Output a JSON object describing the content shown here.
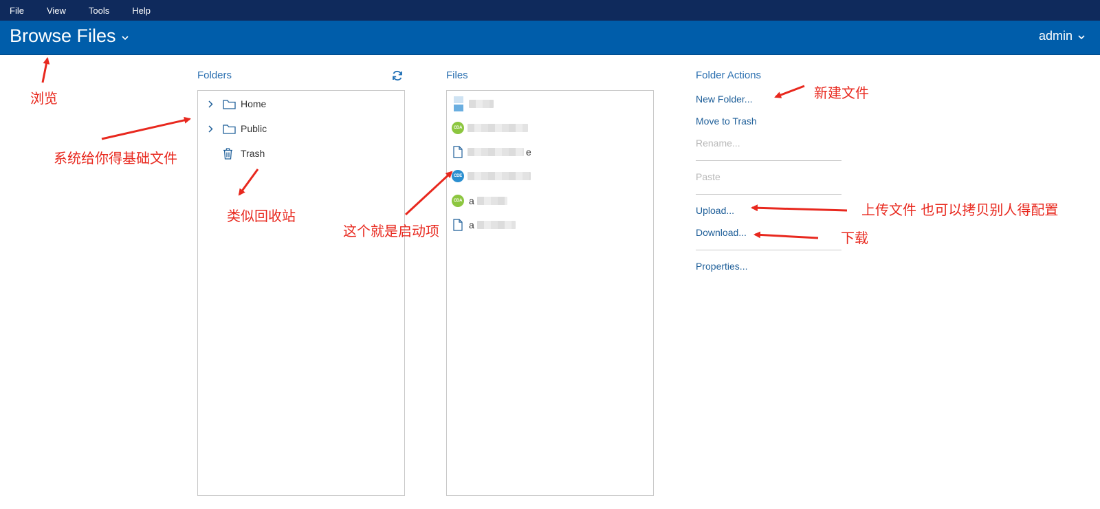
{
  "menubar": {
    "items": [
      "File",
      "View",
      "Tools",
      "Help"
    ]
  },
  "header": {
    "title": "Browse Files",
    "user": "admin"
  },
  "folders": {
    "title": "Folders",
    "items": [
      {
        "label": "Home",
        "icon": "folder-icon",
        "expandable": true
      },
      {
        "label": "Public",
        "icon": "folder-icon",
        "expandable": true
      },
      {
        "label": "Trash",
        "icon": "trash-icon",
        "expandable": false
      }
    ]
  },
  "files": {
    "title": "Files",
    "items": [
      {
        "icon": "image-icon",
        "suffix": ""
      },
      {
        "icon": "cda-badge-icon",
        "badge": "CDA",
        "suffix": ""
      },
      {
        "icon": "file-icon",
        "suffix": "e"
      },
      {
        "icon": "cde-badge-icon",
        "badge": "CDE",
        "suffix": ""
      },
      {
        "icon": "cda-badge-icon",
        "badge": "CDA",
        "suffix": "a"
      },
      {
        "icon": "file-icon",
        "suffix": "a"
      }
    ]
  },
  "actions": {
    "title": "Folder Actions",
    "new_folder": "New Folder...",
    "move_to_trash": "Move to Trash",
    "rename": "Rename...",
    "paste": "Paste",
    "upload": "Upload...",
    "download": "Download...",
    "properties": "Properties..."
  },
  "annotations": {
    "browse": "浏览",
    "base_files": "系统给你得基础文件",
    "recycle": "类似回收站",
    "startup": "这个就是启动项",
    "new_file": "新建文件",
    "upload": "上传文件 也可以拷贝别人得配置",
    "download": "下载"
  },
  "colors": {
    "menubar": "#0f2a5c",
    "header": "#005daa",
    "link": "#1f5f99",
    "annotation": "#e8281e",
    "cda_badge": "#8cc63f",
    "cde_badge": "#2b8fd0"
  }
}
